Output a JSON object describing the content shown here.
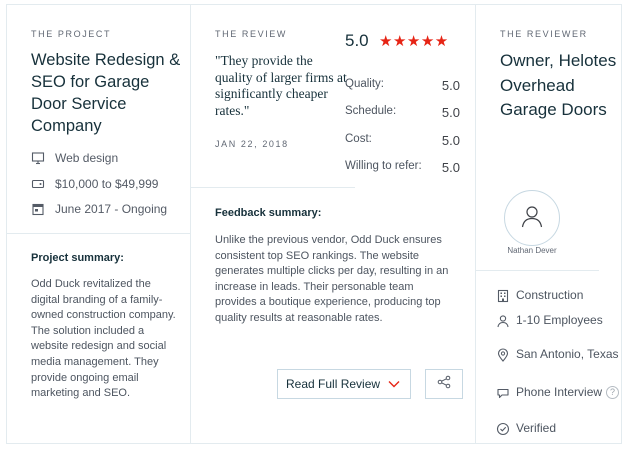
{
  "project": {
    "eyebrow": "THE PROJECT",
    "title": "Website Redesign & SEO for Garage Door Service Company",
    "service": "Web design",
    "budget": "$10,000 to $49,999",
    "timeline": "June 2017 - Ongoing",
    "summary_heading": "Project summary:",
    "summary_text": "Odd Duck revitalized the digital branding of a family-owned construction company. The solution included a website redesign and social media management. They provide ongoing email marketing and SEO."
  },
  "review": {
    "eyebrow": "THE REVIEW",
    "quote": "\"They provide the quality of larger firms at significantly cheaper rates.\"",
    "date": "JAN 22, 2018",
    "overall_score": "5.0",
    "stars": "★★★★★",
    "ratings": [
      {
        "label": "Quality:",
        "value": "5.0"
      },
      {
        "label": "Schedule:",
        "value": "5.0"
      },
      {
        "label": "Cost:",
        "value": "5.0"
      },
      {
        "label": "Willing to refer:",
        "value": "5.0"
      }
    ],
    "feedback_heading": "Feedback summary:",
    "feedback_text": "Unlike the previous vendor, Odd Duck ensures consistent top SEO rankings. The website generates multiple clicks per day, resulting in an increase in leads. Their personable team provides a boutique experience, producing top quality results at reasonable rates.",
    "read_full_label": "Read Full Review"
  },
  "reviewer": {
    "eyebrow": "THE REVIEWER",
    "title": "Owner, Helotes Overhead Garage Doors",
    "name": "Nathan Dever",
    "industry": "Construction",
    "size": "1-10 Employees",
    "location": "San Antonio, Texas",
    "review_type": "Phone Interview",
    "help_symbol": "?",
    "verified": "Verified"
  },
  "colors": {
    "star": "#e62415",
    "heading": "#17313b",
    "border": "#e3ebef",
    "button_border": "#c7d8e2"
  }
}
